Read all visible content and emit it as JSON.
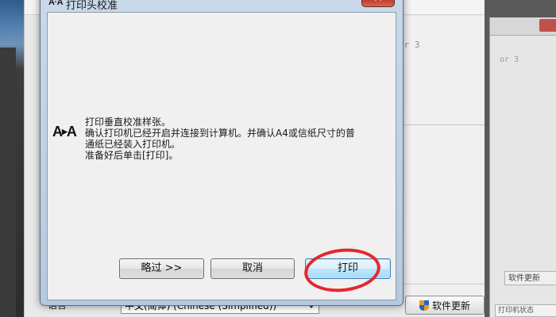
{
  "background": {
    "hint_text": "or 3",
    "language_label": "语言",
    "language_select_value": "中文(简体) (Chinese (Simplified))",
    "update_button_label": "软件更新",
    "right_window": {
      "hint_text": "or 3",
      "update_label": "软件更新",
      "bottom_label": "打印机状态"
    }
  },
  "dialog": {
    "title_logo": "A·A",
    "title": "打印头校准",
    "close_glyph": "✕",
    "icon": "print-alignment-icon",
    "message_lines": [
      "打印垂直校准样张。",
      "确认打印机已经开启并连接到计算机。并确认A4或信纸尺寸的普",
      "通纸已经装入打印机。",
      "准备好后单击[打印]。"
    ],
    "buttons": {
      "skip": "略过 >>",
      "cancel": "取消",
      "print": "打印"
    },
    "highlight_color": "#e6262e"
  }
}
